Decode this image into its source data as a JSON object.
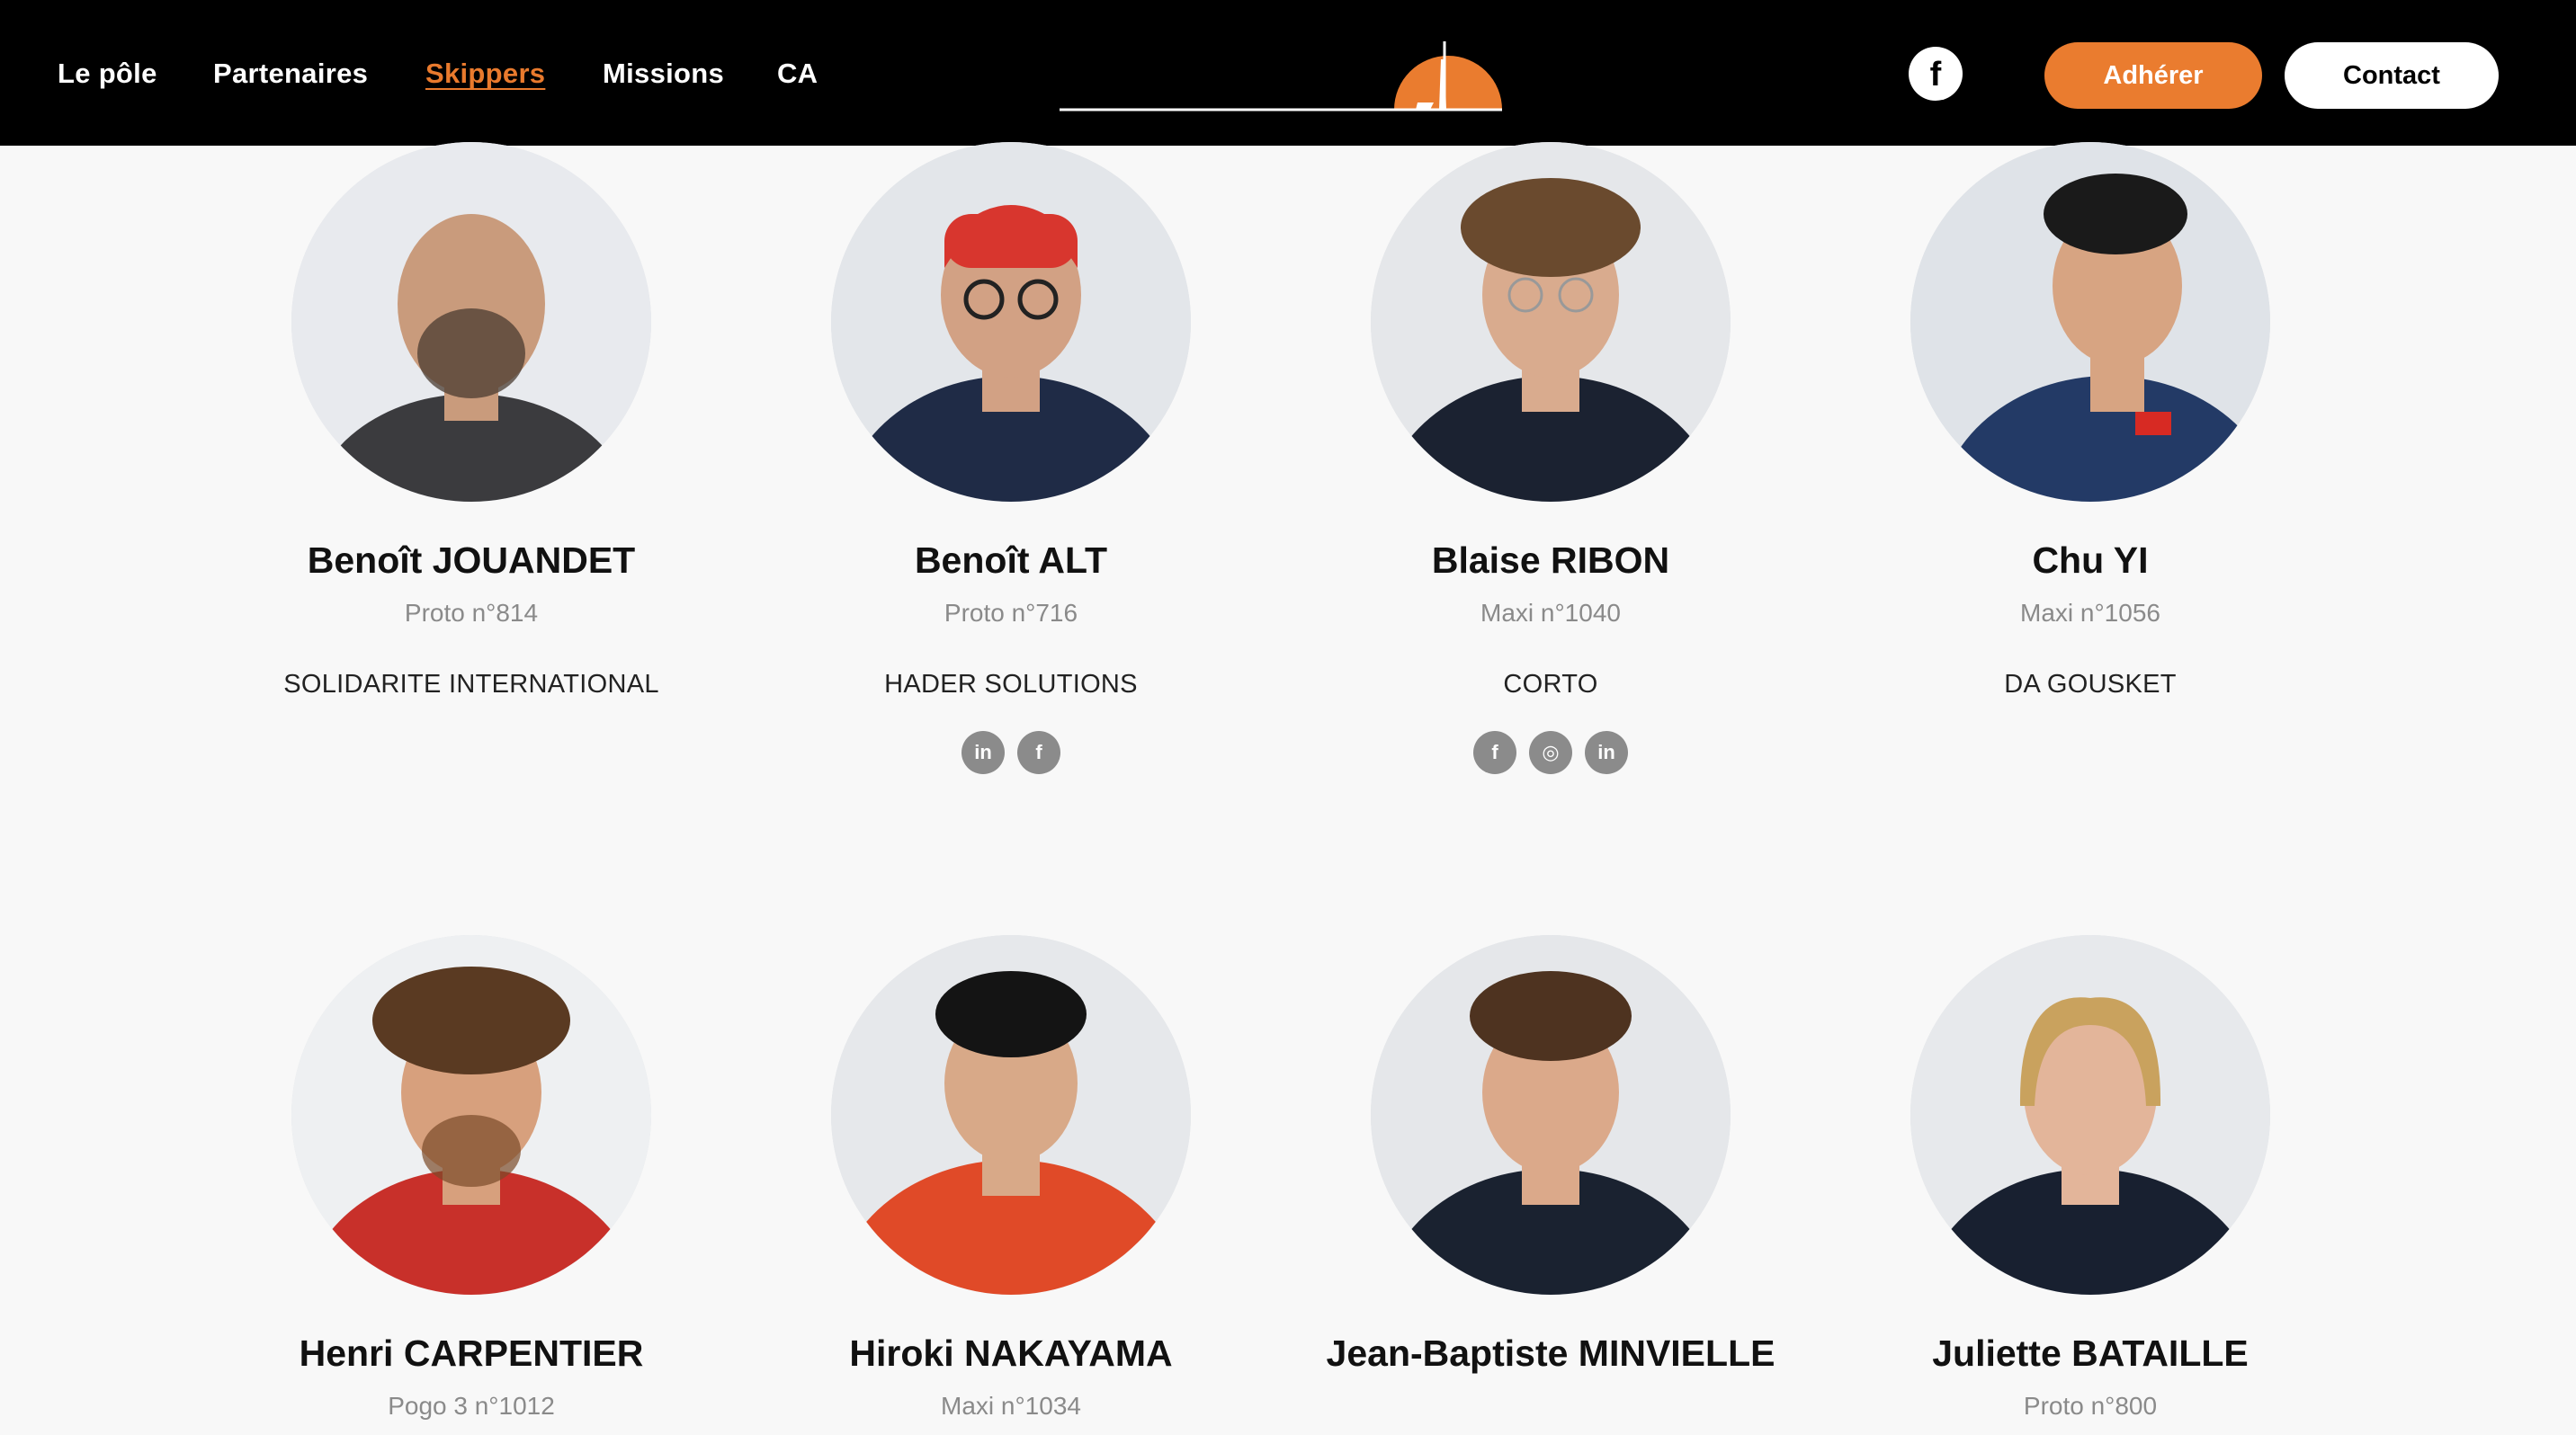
{
  "nav": {
    "items": [
      {
        "label": "Le pôle"
      },
      {
        "label": "Partenaires"
      },
      {
        "label": "Skippers"
      },
      {
        "label": "Missions"
      },
      {
        "label": "CA"
      }
    ],
    "active": "Skippers"
  },
  "header": {
    "facebook_glyph": "f",
    "join_label": "Adhérer",
    "contact_label": "Contact"
  },
  "colors": {
    "accent": "#ea7c2f",
    "header_bg": "#000000",
    "page_bg": "#f8f8f8",
    "social_icon_bg": "#8b8b8b"
  },
  "skippers": [
    {
      "name": "Benoît JOUANDET",
      "boat": "Proto n°814",
      "sponsor": "SOLIDARITE INTERNATIONAL",
      "socials": []
    },
    {
      "name": "Benoît ALT",
      "boat": "Proto n°716",
      "sponsor": "HADER SOLUTIONS",
      "socials": [
        {
          "icon": "linkedin-icon",
          "glyph": "in"
        },
        {
          "icon": "facebook-icon",
          "glyph": "f"
        }
      ]
    },
    {
      "name": "Blaise RIBON",
      "boat": "Maxi n°1040",
      "sponsor": "CORTO",
      "socials": [
        {
          "icon": "facebook-icon",
          "glyph": "f"
        },
        {
          "icon": "instagram-icon",
          "glyph": "◎"
        },
        {
          "icon": "linkedin-icon",
          "glyph": "in"
        }
      ]
    },
    {
      "name": "Chu YI",
      "boat": "Maxi n°1056",
      "sponsor": "DA GOUSKET",
      "socials": []
    },
    {
      "name": "Henri CARPENTIER",
      "boat": "Pogo 3 n°1012",
      "sponsor": "",
      "socials": []
    },
    {
      "name": "Hiroki NAKAYAMA",
      "boat": "Maxi n°1034",
      "sponsor": "",
      "socials": []
    },
    {
      "name": "Jean-Baptiste MINVIELLE",
      "boat": "",
      "sponsor": "",
      "socials": []
    },
    {
      "name": "Juliette BATAILLE",
      "boat": "Proto n°800",
      "sponsor": "",
      "socials": []
    }
  ]
}
